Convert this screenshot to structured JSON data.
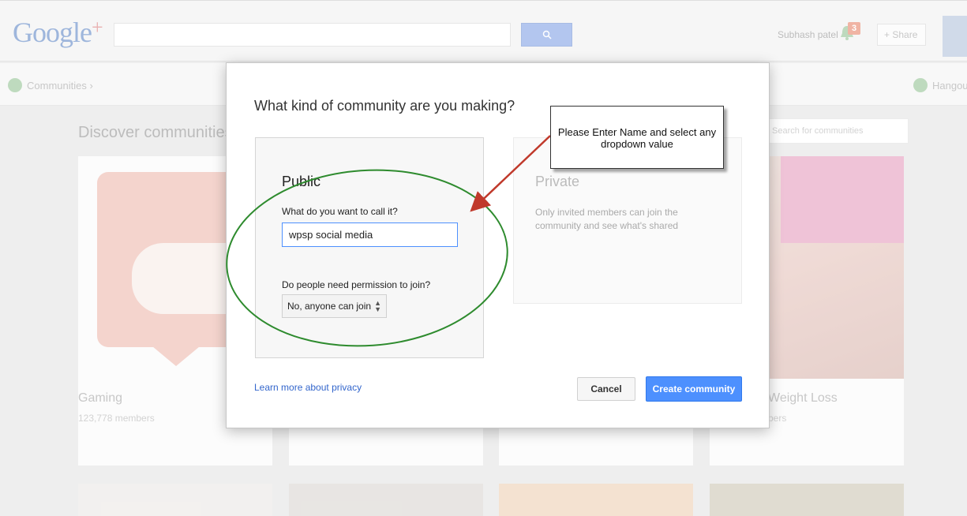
{
  "header": {
    "logo": "Google",
    "logo_plus": "+",
    "search_value": "",
    "user_name": "Subhash patel",
    "notifications_count": "3",
    "share_label": "+ Share"
  },
  "subnav": {
    "communities_label": "Communities ›",
    "hangouts_label": "Hangou"
  },
  "page": {
    "discover_title": "Discover communities",
    "search_placeholder": "Search for communities",
    "cards": [
      {
        "name": "Gaming",
        "members": "123,778 members"
      },
      {
        "name": "",
        "members": ""
      },
      {
        "name": "",
        "members": ""
      },
      {
        "name": "Weight Loss",
        "members": "bers"
      }
    ]
  },
  "dialog": {
    "title": "What kind of community are you making?",
    "public": {
      "heading": "Public",
      "name_label": "What do you want to call it?",
      "name_value": "wpsp social media",
      "permission_label": "Do people need permission to join?",
      "permission_value": "No, anyone can join"
    },
    "private": {
      "heading": "Private",
      "description": "Only invited members can join the community and see what's shared"
    },
    "privacy_link": "Learn more about privacy",
    "cancel_label": "Cancel",
    "create_label": "Create community"
  },
  "annotation": {
    "callout_text": "Please Enter Name and select any dropdown value",
    "arrow_color": "#c0392b",
    "circle_color": "#2e8b2e"
  },
  "colors": {
    "accent_blue": "#4d90fe",
    "link_blue": "#3366cc"
  }
}
